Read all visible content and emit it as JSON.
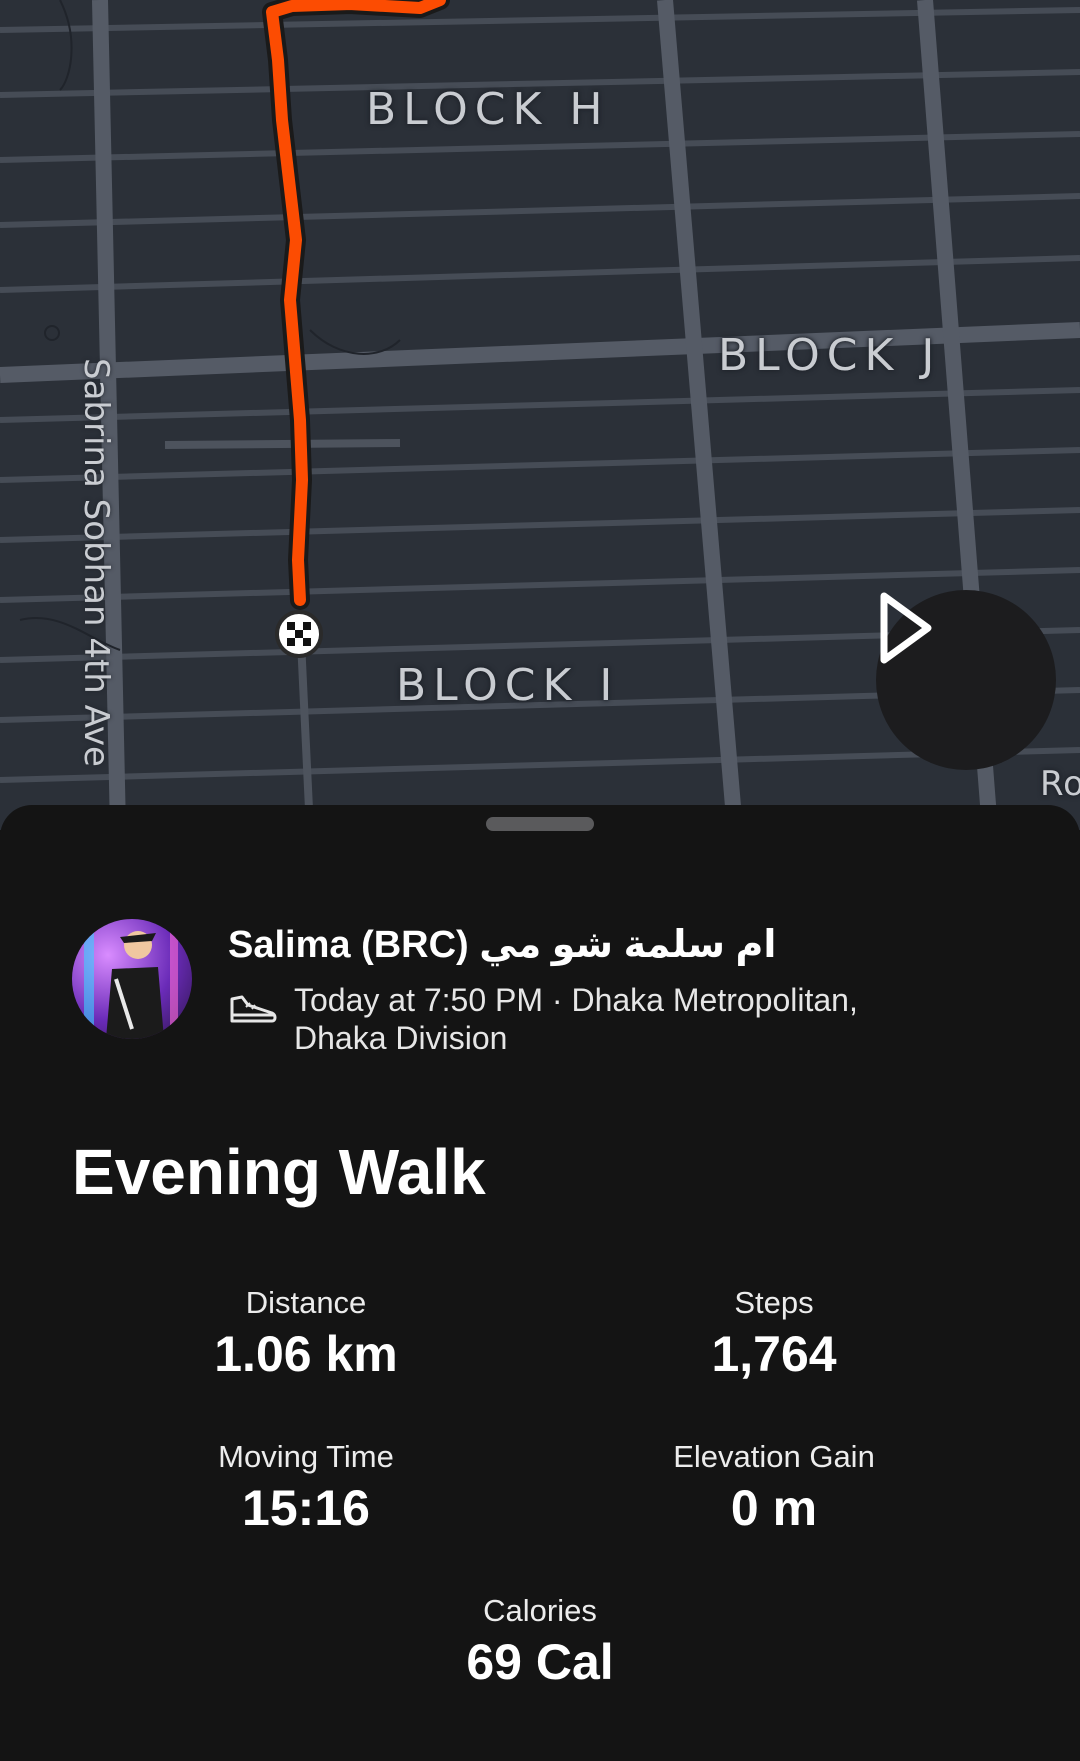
{
  "map": {
    "block_labels": [
      "BLOCK H",
      "BLOCK J",
      "BLOCK I"
    ],
    "street_label": "Sabrina Sobhan 4th Ave",
    "edge_label": "Ro",
    "route_color": "#fc4c02",
    "finish_marker_icon": "checkered-flag-icon",
    "play_icon": "play-icon"
  },
  "activity": {
    "athlete_name": "Salima (BRC) ام سلمة شو مي",
    "activity_type_icon": "walking-shoe-icon",
    "meta": "Today at 7:50 PM · Dhaka Metropolitan, Dhaka Division",
    "title": "Evening Walk"
  },
  "stats": {
    "distance": {
      "label": "Distance",
      "value": "1.06 km"
    },
    "steps": {
      "label": "Steps",
      "value": "1,764"
    },
    "moving_time": {
      "label": "Moving Time",
      "value": "15:16"
    },
    "elevation_gain": {
      "label": "Elevation Gain",
      "value": "0 m"
    },
    "calories": {
      "label": "Calories",
      "value": "69 Cal"
    }
  }
}
